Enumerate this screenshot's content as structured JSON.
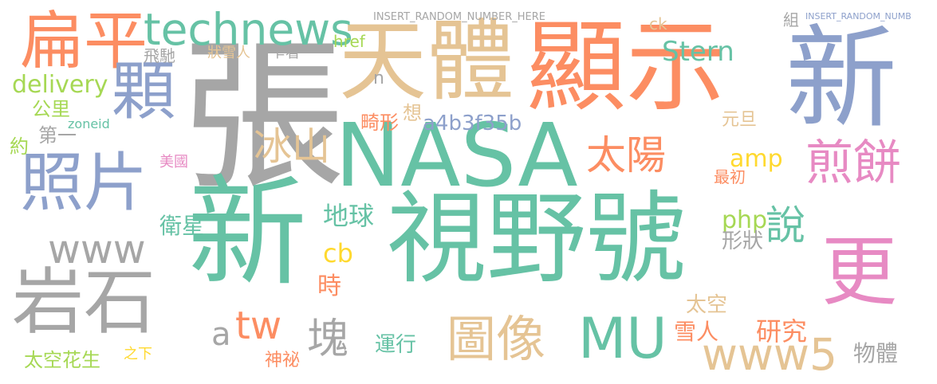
{
  "colors": {
    "grey": "#a6a6a6",
    "teal": "#66c2a5",
    "orange": "#fc8d62",
    "blue": "#8da0cb",
    "pink": "#e78ac3",
    "green": "#a6d854",
    "yellow": "#ffd92f",
    "tan": "#e5c494"
  },
  "words": [
    "張",
    "新",
    "視野號",
    "顯示",
    "天體",
    "NASA",
    "新",
    "扁平",
    "technews",
    "顆",
    "照片",
    "岩石",
    "圖像",
    "MU",
    "煎餅",
    "更",
    "www5",
    "太陽",
    "塊",
    "說",
    "冰山",
    "Stern",
    "delivery",
    "公里",
    "第一",
    "約",
    "美國",
    "www",
    "衛星",
    "時",
    "tw",
    "太空花生",
    "運行",
    "神祕",
    "研究",
    "雪人",
    "物體",
    "地球",
    "php",
    "形狀",
    "amp",
    "cb",
    "a4b3f35b",
    "太空",
    "最初",
    "元旦",
    "畸形",
    "想",
    "飛馳",
    "狀雪人",
    "乍看",
    "href",
    "INSERT_RANDOM_NUMBER_HERE",
    "ck",
    "組",
    "INSERT_RANDOM_NUMB",
    "zoneid",
    "n",
    "a",
    "之下"
  ]
}
